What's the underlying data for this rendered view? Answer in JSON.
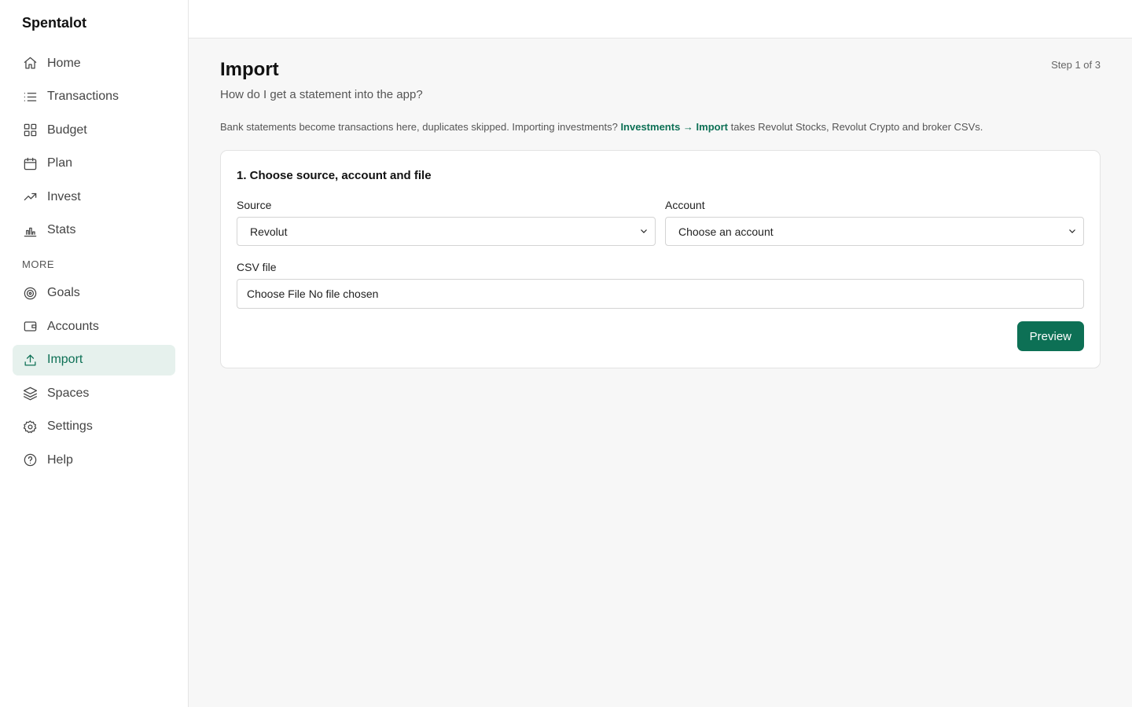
{
  "app": {
    "name": "Spentalot"
  },
  "sidebar": {
    "items": [
      {
        "label": "Home",
        "icon": "home-icon"
      },
      {
        "label": "Transactions",
        "icon": "list-icon"
      },
      {
        "label": "Budget",
        "icon": "grid-icon"
      },
      {
        "label": "Plan",
        "icon": "calendar-icon"
      },
      {
        "label": "Invest",
        "icon": "trending-up-icon"
      },
      {
        "label": "Stats",
        "icon": "bar-chart-icon"
      }
    ],
    "more_label": "MORE",
    "more_items": [
      {
        "label": "Goals",
        "icon": "target-icon"
      },
      {
        "label": "Accounts",
        "icon": "wallet-icon"
      },
      {
        "label": "Import",
        "icon": "upload-icon",
        "active": true
      },
      {
        "label": "Spaces",
        "icon": "layers-icon"
      },
      {
        "label": "Settings",
        "icon": "gear-icon"
      },
      {
        "label": "Help",
        "icon": "help-circle-icon"
      }
    ]
  },
  "page": {
    "title": "Import",
    "subtitle": "How do I get a statement into the app?",
    "step": "Step 1 of 3",
    "info_prefix": "Bank statements become transactions here, duplicates skipped. Importing investments? ",
    "info_link": "Investments → Import",
    "info_suffix": " takes Revolut Stocks, Revolut Crypto and broker CSVs."
  },
  "card": {
    "title": "1. Choose source, account and file",
    "source_label": "Source",
    "source_value": "Revolut",
    "account_label": "Account",
    "account_value": "Choose an account",
    "csv_label": "CSV file",
    "file_button": "Choose File",
    "file_status": "No file chosen",
    "preview_button": "Preview"
  },
  "colors": {
    "accent": "#0d7055",
    "active_bg": "#e6f1ed"
  }
}
